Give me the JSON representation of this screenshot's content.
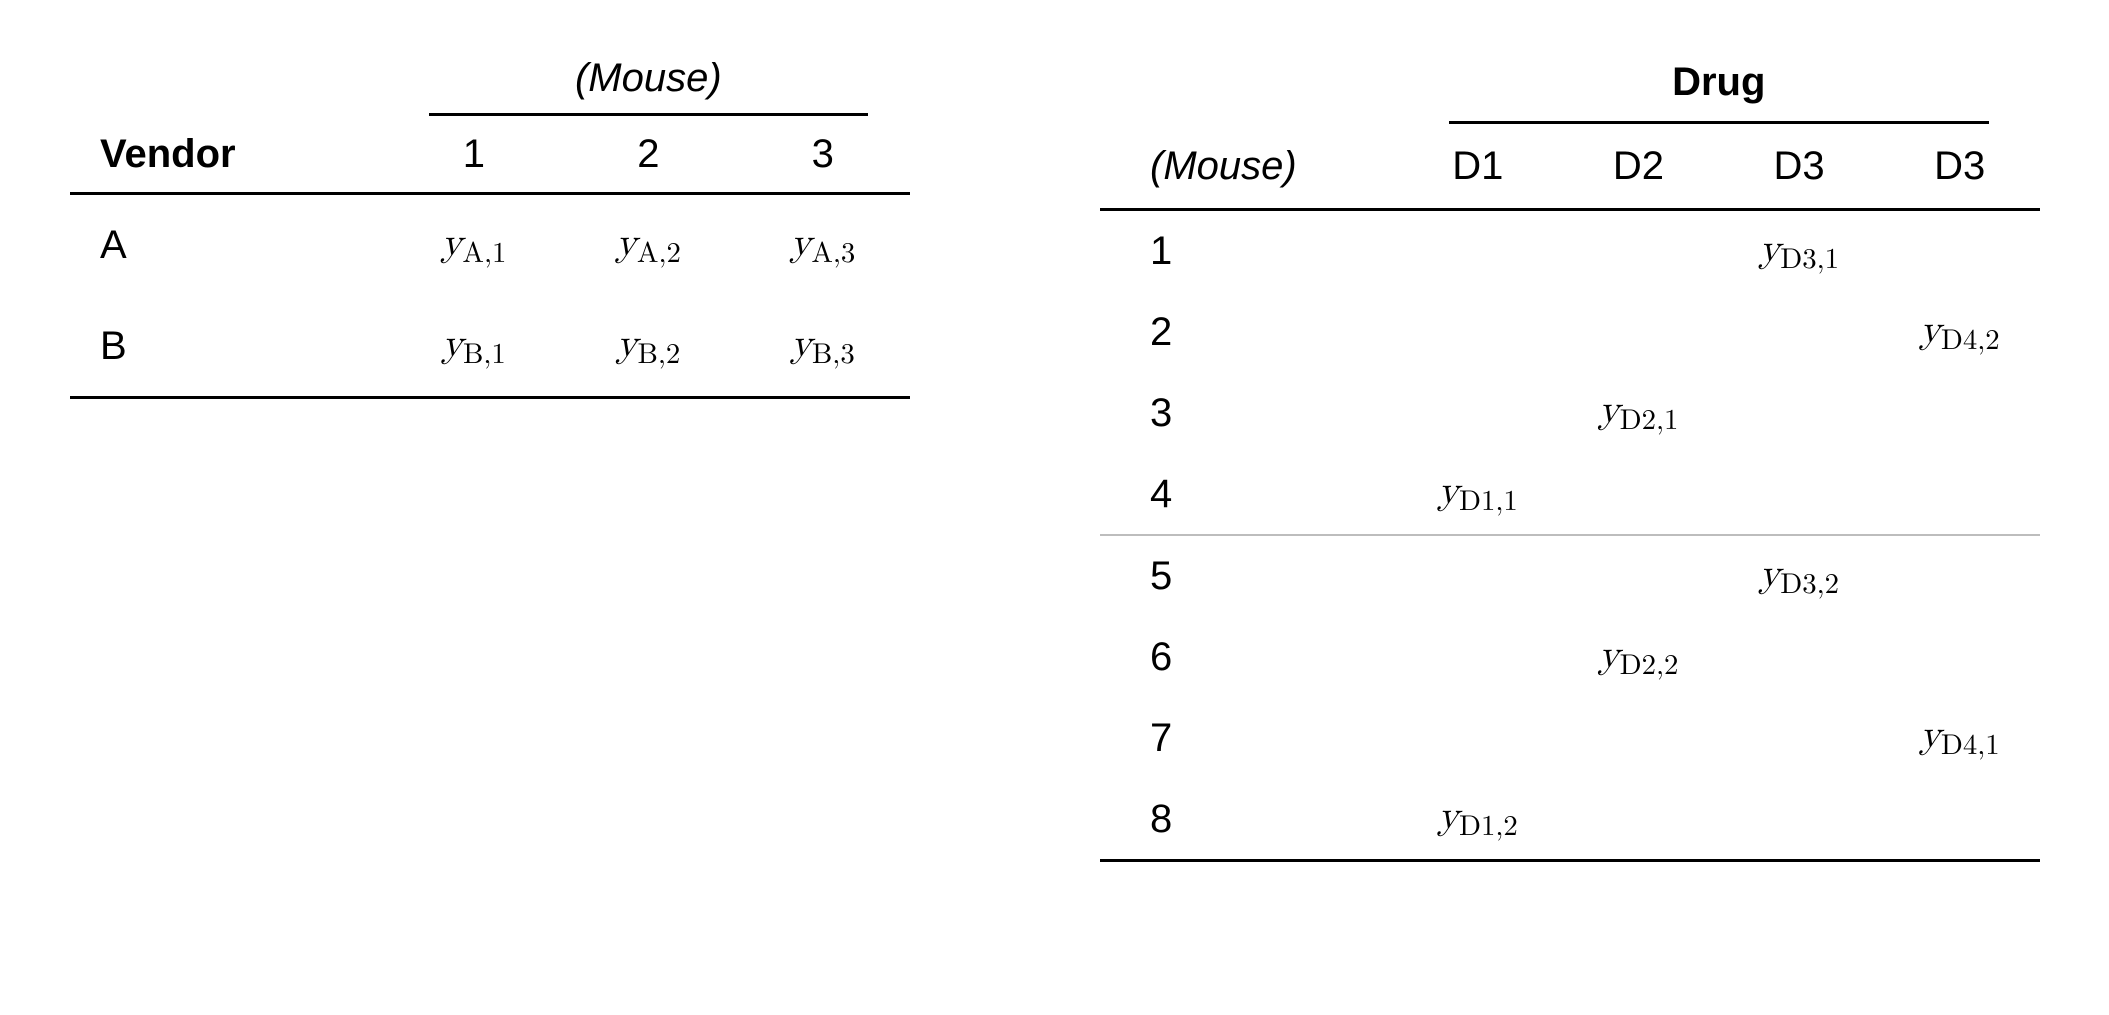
{
  "left": {
    "spanner": "(Mouse)",
    "rowHeader": "Vendor",
    "cols": [
      "1",
      "2",
      "3"
    ],
    "rows": [
      {
        "label": "A",
        "cells": {
          "c1": {
            "v": "y",
            "s": "A,1"
          },
          "c2": {
            "v": "y",
            "s": "A,2"
          },
          "c3": {
            "v": "y",
            "s": "A,3"
          }
        }
      },
      {
        "label": "B",
        "cells": {
          "c1": {
            "v": "y",
            "s": "B,1"
          },
          "c2": {
            "v": "y",
            "s": "B,2"
          },
          "c3": {
            "v": "y",
            "s": "B,3"
          }
        }
      }
    ]
  },
  "right": {
    "spanner": "Drug",
    "rowHeader": "(Mouse)",
    "cols": [
      "D1",
      "D2",
      "D3",
      "D3"
    ],
    "rows": [
      {
        "label": "1",
        "cells": {
          "c3": {
            "v": "y",
            "s": "D3,1"
          }
        }
      },
      {
        "label": "2",
        "cells": {
          "c4": {
            "v": "y",
            "s": "D4,2"
          }
        }
      },
      {
        "label": "3",
        "cells": {
          "c2": {
            "v": "y",
            "s": "D2,1"
          }
        }
      },
      {
        "label": "4",
        "cells": {
          "c1": {
            "v": "y",
            "s": "D1,1"
          }
        }
      },
      {
        "label": "5",
        "cells": {
          "c3": {
            "v": "y",
            "s": "D3,2"
          }
        }
      },
      {
        "label": "6",
        "cells": {
          "c2": {
            "v": "y",
            "s": "D2,2"
          }
        }
      },
      {
        "label": "7",
        "cells": {
          "c4": {
            "v": "y",
            "s": "D4,1"
          }
        }
      },
      {
        "label": "8",
        "cells": {
          "c1": {
            "v": "y",
            "s": "D1,2"
          }
        }
      }
    ]
  }
}
